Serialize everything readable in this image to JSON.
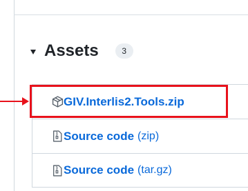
{
  "assets": {
    "title": "Assets",
    "count": "3",
    "items": [
      {
        "name": "GIV.Interlis2.Tools.zip",
        "suffix": "",
        "icon": "package-icon"
      },
      {
        "name": "Source code",
        "suffix": "(zip)",
        "icon": "file-zip-icon"
      },
      {
        "name": "Source code",
        "suffix": "(tar.gz)",
        "icon": "file-zip-icon"
      }
    ]
  },
  "colors": {
    "link": "#0969da",
    "highlight": "#e8111b",
    "text": "#1f2328",
    "border": "#d0d7de"
  }
}
